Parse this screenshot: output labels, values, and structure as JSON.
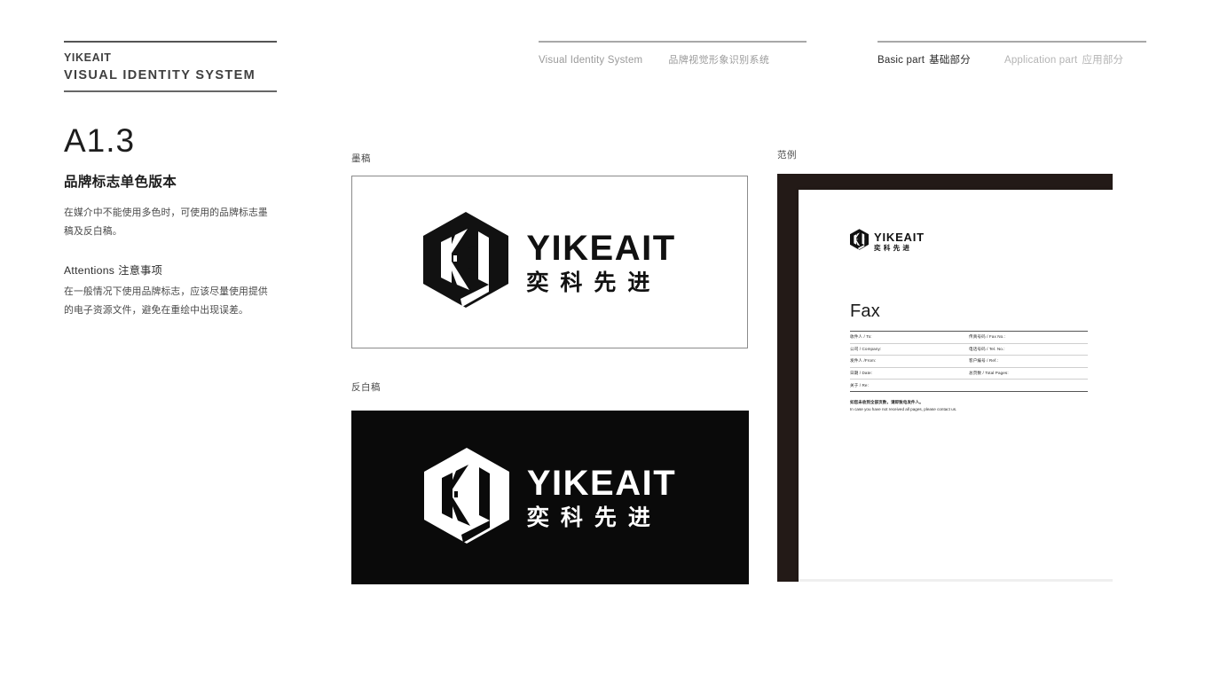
{
  "header": {
    "brand": {
      "line1": "YIKEAIT",
      "line2": "VISUAL IDENTITY SYSTEM"
    },
    "middle": {
      "en": "Visual Identity System",
      "cn": "品牌视觉形象识别系统"
    },
    "tabs": [
      {
        "en": "Basic part",
        "cn": "基础部分",
        "active": true
      },
      {
        "en": "Application part",
        "cn": "应用部分",
        "active": false
      }
    ]
  },
  "left": {
    "section_number": "A1.3",
    "section_title": "品牌标志单色版本",
    "section_body": "在媒介中不能使用多色时，可使用的品牌标志墨稿及反白稿。",
    "attentions_heading_en": "Attentions",
    "attentions_heading_cn": "注意事项",
    "attentions_body": "在一般情况下使用品牌标志，应该尽量使用提供的电子资源文件，避免在重绘中出现误差。"
  },
  "blocks": {
    "ink_label": "墨稿",
    "reverse_label": "反白稿",
    "sample_label": "范例"
  },
  "logo": {
    "wordmark_en": "YIKEAIT",
    "wordmark_cn": "奕科先进",
    "mark_name": "yikeait-hexagon-k-mark"
  },
  "fax": {
    "title": "Fax",
    "rows": [
      {
        "left": "收件人 / To:",
        "right": "传真号码 / Fax No.:"
      },
      {
        "left": "公司 / Company:",
        "right": "电话号码 / Tel. No.:"
      },
      {
        "left": "发件人 /From:",
        "right": "客户编号 / Ref.:"
      },
      {
        "left": "日期 / Date:",
        "right": "总页数 / Total Pages:"
      },
      {
        "left": "关于 / Re:",
        "right": ""
      }
    ],
    "note_cn": "如您未收到全部页数，请即致电发件人。",
    "note_en": "In case you have not received all pages, please contact us."
  },
  "colors": {
    "ink_black": "#0a0a0a",
    "frame_dark": "#231a17",
    "rule_gray": "#a8a8a8",
    "text_gray": "#4a4a4a",
    "muted_gray": "#b4b4b4"
  }
}
